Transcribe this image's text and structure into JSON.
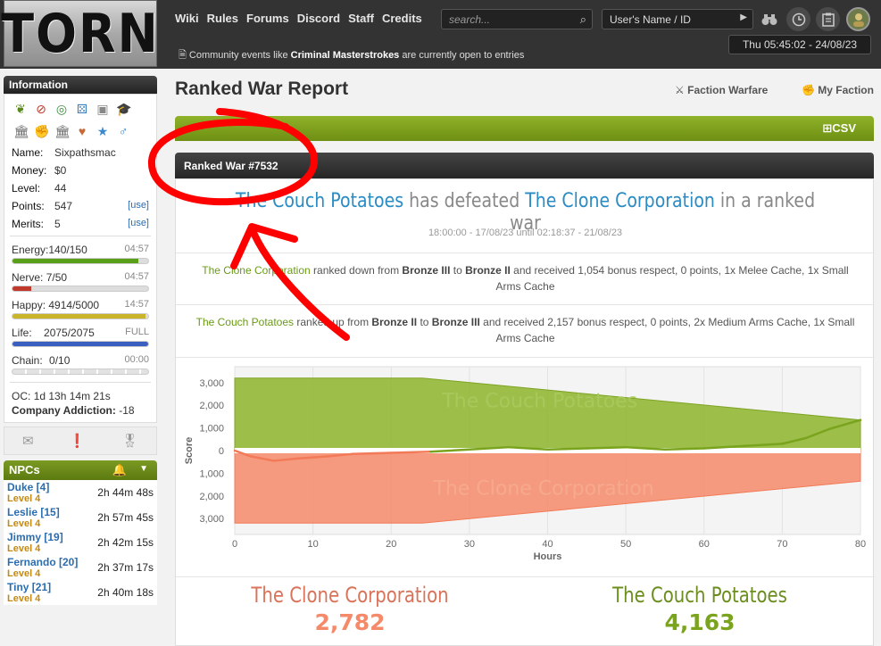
{
  "header": {
    "logo": "TORN",
    "nav": [
      "Wiki",
      "Rules",
      "Forums",
      "Discord",
      "Staff",
      "Credits"
    ],
    "search_placeholder": "search...",
    "user_placeholder": "User's Name / ID",
    "clock": "Thu 05:45:02 - 24/08/23",
    "announcement_pre": "Community events like",
    "announcement_bold": "Criminal Masterstrokes",
    "announcement_post": "are currently open to entries"
  },
  "sidebar": {
    "info_title": "Information",
    "name_label": "Name:",
    "name_value": "Sixpathsmac",
    "money_label": "Money:",
    "money_value": "$0",
    "level_label": "Level:",
    "level_value": "44",
    "points_label": "Points:",
    "points_value": "547",
    "points_use": "[use]",
    "merits_label": "Merits:",
    "merits_value": "5",
    "merits_use": "[use]",
    "energy": {
      "label": "Energy:",
      "value": "140/150",
      "time": "04:57",
      "pct": 93,
      "color": "#5a9f1a"
    },
    "nerve": {
      "label": "Nerve:",
      "value": "7/50",
      "time": "04:57",
      "pct": 14,
      "color": "#c0392b"
    },
    "happy": {
      "label": "Happy:",
      "value": "4914/5000",
      "time": "14:57",
      "pct": 98,
      "color": "#c9b42a"
    },
    "life": {
      "label": "Life:",
      "value": "2075/2075",
      "time": "FULL",
      "pct": 100,
      "color": "#3b5fc0"
    },
    "chain": {
      "label": "Chain:",
      "value": "0/10",
      "time": "00:00",
      "pct": 0,
      "color": "#999999"
    },
    "oc_label": "OC:",
    "oc_value": "1d 13h 14m 21s",
    "addiction_label": "Company Addiction:",
    "addiction_value": "-18",
    "npcs_title": "NPCs",
    "npcs": [
      {
        "name": "Duke [4]",
        "level": "Level 4",
        "time": "2h 44m 48s"
      },
      {
        "name": "Leslie [15]",
        "level": "Level 4",
        "time": "2h 57m 45s"
      },
      {
        "name": "Jimmy [19]",
        "level": "Level 4",
        "time": "2h 42m 15s"
      },
      {
        "name": "Fernando [20]",
        "level": "Level 4",
        "time": "2h 37m 17s"
      },
      {
        "name": "Tiny [21]",
        "level": "Level 4",
        "time": "2h 40m 18s"
      }
    ]
  },
  "main": {
    "title": "Ranked War Report",
    "faction_warfare": "Faction Warfare",
    "my_faction": "My Faction",
    "csv": "CSV",
    "war_title": "Ranked War #7532",
    "winner": "The Couch Potatoes",
    "verb": "has defeated",
    "loser": "The Clone Corporation",
    "suffix": "in a ranked war",
    "date_range": "18:00:00 - 17/08/23 until 02:18:37 - 21/08/23",
    "result1_team": "The Clone Corporation",
    "result1_text": "ranked down from",
    "result1_from": "Bronze III",
    "result1_to": "Bronze II",
    "result1_rest": "and received 1,054 bonus respect, 0 points, 1x Melee Cache, 1x Small Arms Cache",
    "result2_team": "The Couch Potatoes",
    "result2_text": "ranked up from",
    "result2_from": "Bronze II",
    "result2_to": "Bronze III",
    "result2_rest": "and received 2,157 bonus respect, 0 points, 2x Medium Arms Cache, 1x Small Arms Cache",
    "to_word": "to",
    "final_left_team": "The Clone Corporation",
    "final_left_score": "2,782",
    "final_right_team": "The Couch Potatoes",
    "final_right_score": "4,163",
    "colors": {
      "winner_green": "#7a9e1e",
      "loser_orange": "#f0896a",
      "link_blue": "#2a8cc4"
    }
  },
  "chart_data": {
    "type": "area",
    "xlabel": "Hours",
    "ylabel": "Score",
    "xticks": [
      0,
      10,
      20,
      30,
      40,
      50,
      60,
      70,
      80
    ],
    "yticks_top": [
      "3,000",
      "2,000",
      "1,000",
      "0"
    ],
    "yticks_bottom": [
      "1,000",
      "2,000",
      "3,000"
    ],
    "xlim": [
      0,
      80
    ],
    "series": [
      {
        "name": "The Couch Potatoes",
        "color": "#8db52b",
        "target": {
          "x": [
            0,
            20,
            24,
            80
          ],
          "y": [
            3200,
            3200,
            3200,
            1350
          ]
        }
      },
      {
        "name": "The Clone Corporation",
        "color": "#f58a6a",
        "target": {
          "x": [
            0,
            20,
            24,
            80
          ],
          "y": [
            -3200,
            -3200,
            -3200,
            -1350
          ]
        }
      }
    ],
    "lead": {
      "x": [
        0,
        2,
        5,
        8,
        12,
        15,
        20,
        25,
        30,
        35,
        40,
        45,
        50,
        55,
        60,
        65,
        70,
        73,
        76,
        80
      ],
      "y": [
        0,
        -250,
        -450,
        -350,
        -250,
        -150,
        -100,
        -50,
        50,
        150,
        50,
        100,
        150,
        50,
        100,
        200,
        300,
        550,
        950,
        1350
      ]
    }
  }
}
